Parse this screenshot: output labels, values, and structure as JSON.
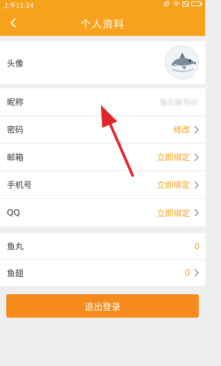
{
  "status": {
    "time": "上午11:24"
  },
  "header": {
    "title": "个人资料"
  },
  "profile": {
    "avatar_label": "头像",
    "nickname_label": "昵称",
    "nickname_value": "鱼丸账号ID",
    "password_label": "密码",
    "password_action": "修改",
    "email_label": "邮箱",
    "email_action": "立即绑定",
    "phone_label": "手机号",
    "phone_action": "立即绑定",
    "qq_label": "QQ",
    "qq_action": "立即绑定"
  },
  "wallet": {
    "yuwan_label": "鱼丸",
    "yuwan_value": "0",
    "yuchi_label": "鱼翅",
    "yuchi_value": "0"
  },
  "footer": {
    "logout_label": "退出登录"
  },
  "colors": {
    "accent": "#f6a21c",
    "button": "#f58b1c",
    "annotation": "#e0252b"
  }
}
